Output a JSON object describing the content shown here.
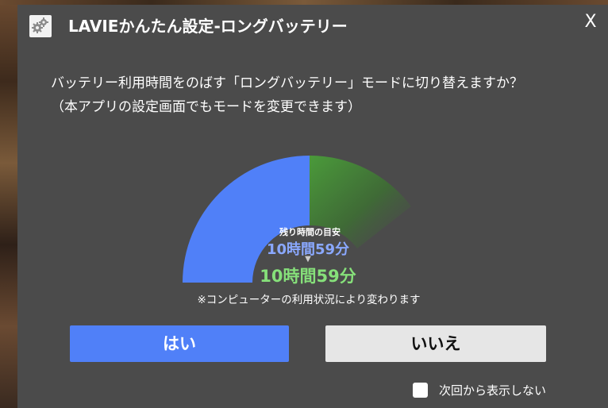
{
  "window": {
    "title": "LAVIEかんたん設定-ロングバッテリー",
    "close_label": "X",
    "app_icon": "gears-icon"
  },
  "message": {
    "line1": "バッテリー利用時間をのばす「ロングバッテリー」モードに切り替えますか？",
    "line2": "（本アプリの設定画面でもモードを変更できます）"
  },
  "gauge": {
    "label": "残り時間の目安",
    "current_time": "10時間59分",
    "new_time": "10時間59分",
    "arrow": "▼",
    "note": "※コンピューターの利用状況により変わります",
    "colors": {
      "current": "#5080f8",
      "extended": "#4a9a3a"
    }
  },
  "buttons": {
    "yes": "はい",
    "no": "いいえ"
  },
  "checkbox": {
    "label": "次回から表示しない",
    "checked": false
  }
}
